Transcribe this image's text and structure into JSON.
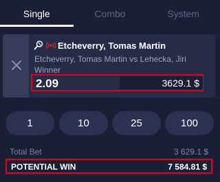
{
  "tabs": [
    {
      "label": "Single",
      "active": true
    },
    {
      "label": "Combo",
      "active": false
    },
    {
      "label": "System",
      "active": false
    }
  ],
  "bet": {
    "sport_icon": "tennis-racket-icon",
    "live_icon": "live-broadcast-icon",
    "selection": "Etcheverry, Tomas Martin",
    "match": "Etcheverry, Tomas Martin vs Lehecka, Jiri",
    "market": "Winner",
    "odds": "2.09",
    "stake": "3629.1 $"
  },
  "quick_stakes": [
    "1",
    "10",
    "25",
    "100"
  ],
  "summary": {
    "total_bet_label": "Total Bet",
    "total_bet_value": "3 629.1 $",
    "potential_win_label": "POTENTIAL WIN",
    "potential_win_value": "7 584.81 $"
  },
  "colors": {
    "background": "#1b1f36",
    "card": "#262b47",
    "highlight_border": "#e3001b",
    "live_red": "#e8202a",
    "muted_text": "#9aa1bf"
  }
}
